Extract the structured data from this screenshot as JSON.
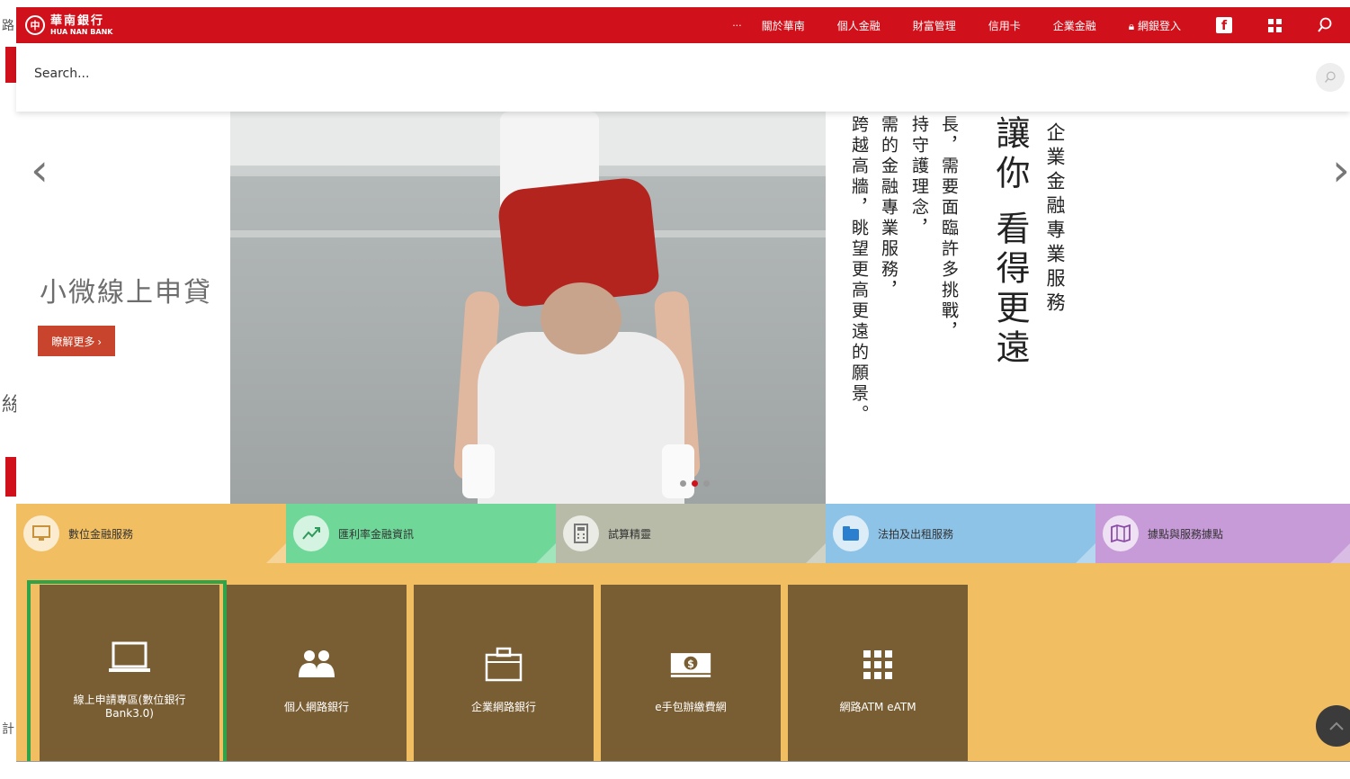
{
  "left_residue": {
    "char1": "路",
    "char2": "絲",
    "char3": "計"
  },
  "header": {
    "logo_zh": "華南銀行",
    "logo_en": "HUA NAN BANK",
    "more_dots": "···",
    "nav": [
      "關於華南",
      "個人金融",
      "財富管理",
      "信用卡",
      "企業金融"
    ],
    "login_label": "網銀登入"
  },
  "search": {
    "placeholder": "Search..."
  },
  "hero": {
    "slide_title": "小微線上申貸",
    "more_button": "瞭解更多 ›",
    "prev_arrow": "‹",
    "next_arrow": "›",
    "vertical_lines": [
      "跨越高牆，眺望更高更遠的願景。",
      "需的金融專業服務，",
      "持守護理念，",
      "長，需要面臨許多挑戰，",
      "讓你 看得更遠",
      "企業金融專業服務"
    ],
    "dot_count": 3,
    "active_dot": 1
  },
  "categories": [
    {
      "label": "數位金融服務",
      "color": "#f2be62",
      "icon": "monitor-icon"
    },
    {
      "label": "匯利率金融資訊",
      "color": "#6fd898",
      "icon": "trend-icon"
    },
    {
      "label": "試算精靈",
      "color": "#b7bba8",
      "icon": "calculator-icon"
    },
    {
      "label": "法拍及出租服務",
      "color": "#8ec3e8",
      "icon": "folder-icon"
    },
    {
      "label": "據點與服務據點",
      "color": "#c79ad8",
      "icon": "map-icon"
    }
  ],
  "tiles": [
    {
      "label": "線上申請專區(數位銀行\nBank3.0)",
      "icon": "laptop-icon"
    },
    {
      "label": "個人網路銀行",
      "icon": "users-icon"
    },
    {
      "label": "企業網路銀行",
      "icon": "briefcase-icon"
    },
    {
      "label": "e手包辦繳費網",
      "icon": "money-icon"
    },
    {
      "label": "網路ATM eATM",
      "icon": "grid-icon"
    }
  ]
}
